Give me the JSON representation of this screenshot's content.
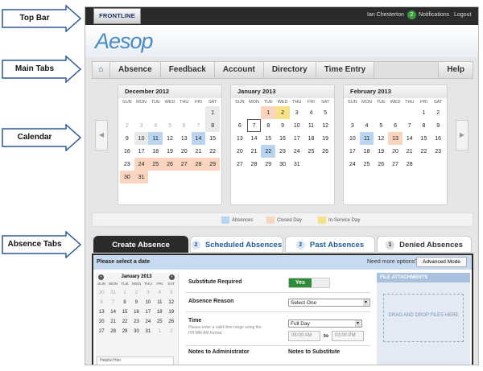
{
  "annotations": {
    "top_bar": "Top Bar",
    "main_tabs": "Main Tabs",
    "calendar": "Calendar",
    "absence_tabs": "Absence Tabs"
  },
  "topbar": {
    "logo": "FRONTLINE",
    "user": "Ian Chesterton",
    "notifications_count": "2",
    "notifications": "Notifications",
    "logout": "Logout"
  },
  "brand": {
    "name": "Aesop"
  },
  "tabs": {
    "home_icon": "home-icon",
    "absence": "Absence",
    "feedback": "Feedback",
    "account": "Account",
    "directory": "Directory",
    "time_entry": "Time Entry",
    "help": "Help"
  },
  "calendars": [
    {
      "title": "December 2012",
      "dow": [
        "SUN",
        "MON",
        "TUE",
        "WED",
        "THU",
        "FRI",
        "SAT"
      ],
      "weeks": [
        [
          [
            "",
            ""
          ],
          [
            "",
            ""
          ],
          [
            "",
            ""
          ],
          [
            "",
            ""
          ],
          [
            "",
            ""
          ],
          [
            "",
            ""
          ],
          [
            "1",
            "g"
          ]
        ],
        [
          [
            "2",
            "o"
          ],
          [
            "3",
            "o"
          ],
          [
            "4",
            "o"
          ],
          [
            "5",
            "o"
          ],
          [
            "6",
            "o"
          ],
          [
            "7",
            "o"
          ],
          [
            "8",
            "g"
          ]
        ],
        [
          [
            "9",
            ""
          ],
          [
            "10",
            "g"
          ],
          [
            "11",
            "a"
          ],
          [
            "12",
            ""
          ],
          [
            "13",
            ""
          ],
          [
            "14",
            "a"
          ],
          [
            "15",
            ""
          ]
        ],
        [
          [
            "16",
            ""
          ],
          [
            "17",
            ""
          ],
          [
            "18",
            ""
          ],
          [
            "19",
            ""
          ],
          [
            "20",
            ""
          ],
          [
            "21",
            ""
          ],
          [
            "22",
            ""
          ]
        ],
        [
          [
            "23",
            ""
          ],
          [
            "24",
            "c"
          ],
          [
            "25",
            "c"
          ],
          [
            "26",
            "c"
          ],
          [
            "27",
            "c"
          ],
          [
            "28",
            "c"
          ],
          [
            "29",
            "c"
          ]
        ],
        [
          [
            "30",
            "c"
          ],
          [
            "31",
            "c"
          ],
          [
            "",
            ""
          ],
          [
            "",
            ""
          ],
          [
            "",
            ""
          ],
          [
            "",
            ""
          ],
          [
            "",
            ""
          ]
        ]
      ]
    },
    {
      "title": "January 2013",
      "dow": [
        "SUN",
        "MON",
        "TUE",
        "WED",
        "THU",
        "FRI",
        "SAT"
      ],
      "weeks": [
        [
          [
            "",
            ""
          ],
          [
            "",
            ""
          ],
          [
            "1",
            "c"
          ],
          [
            "2",
            "i"
          ],
          [
            "3",
            ""
          ],
          [
            "4",
            ""
          ],
          [
            "5",
            ""
          ]
        ],
        [
          [
            "6",
            ""
          ],
          [
            "7",
            "t"
          ],
          [
            "8",
            ""
          ],
          [
            "9",
            ""
          ],
          [
            "10",
            ""
          ],
          [
            "11",
            ""
          ],
          [
            "12",
            ""
          ]
        ],
        [
          [
            "13",
            ""
          ],
          [
            "14",
            ""
          ],
          [
            "15",
            ""
          ],
          [
            "16",
            ""
          ],
          [
            "17",
            ""
          ],
          [
            "18",
            ""
          ],
          [
            "19",
            ""
          ]
        ],
        [
          [
            "20",
            ""
          ],
          [
            "21",
            ""
          ],
          [
            "22",
            "a"
          ],
          [
            "23",
            ""
          ],
          [
            "24",
            ""
          ],
          [
            "25",
            ""
          ],
          [
            "26",
            ""
          ]
        ],
        [
          [
            "27",
            ""
          ],
          [
            "28",
            ""
          ],
          [
            "29",
            ""
          ],
          [
            "30",
            ""
          ],
          [
            "31",
            ""
          ],
          [
            "",
            ""
          ],
          [
            "",
            ""
          ]
        ]
      ]
    },
    {
      "title": "February 2013",
      "dow": [
        "SUN",
        "MON",
        "TUE",
        "WED",
        "THU",
        "FRI",
        "SAT"
      ],
      "weeks": [
        [
          [
            "",
            ""
          ],
          [
            "",
            ""
          ],
          [
            "",
            ""
          ],
          [
            "",
            ""
          ],
          [
            "",
            ""
          ],
          [
            "1",
            ""
          ],
          [
            "2",
            ""
          ]
        ],
        [
          [
            "3",
            ""
          ],
          [
            "4",
            ""
          ],
          [
            "5",
            ""
          ],
          [
            "6",
            ""
          ],
          [
            "7",
            ""
          ],
          [
            "8",
            ""
          ],
          [
            "9",
            ""
          ]
        ],
        [
          [
            "10",
            ""
          ],
          [
            "11",
            "a"
          ],
          [
            "12",
            ""
          ],
          [
            "13",
            "c"
          ],
          [
            "14",
            ""
          ],
          [
            "15",
            ""
          ],
          [
            "16",
            ""
          ]
        ],
        [
          [
            "17",
            ""
          ],
          [
            "18",
            ""
          ],
          [
            "19",
            ""
          ],
          [
            "20",
            ""
          ],
          [
            "21",
            ""
          ],
          [
            "22",
            ""
          ],
          [
            "23",
            ""
          ]
        ],
        [
          [
            "24",
            ""
          ],
          [
            "25",
            ""
          ],
          [
            "26",
            ""
          ],
          [
            "27",
            ""
          ],
          [
            "28",
            ""
          ],
          [
            "",
            ""
          ],
          [
            "",
            ""
          ]
        ]
      ]
    }
  ],
  "legend": {
    "absences": "Absences",
    "closed": "Closed Day",
    "inservice": "In-Service Day"
  },
  "absence_tabs": {
    "create": "Create Absence",
    "scheduled_count": "2",
    "scheduled": "Scheduled Absences",
    "past_count": "2",
    "past": "Past Absences",
    "denied_count": "1",
    "denied": "Denied Absences"
  },
  "panel": {
    "prompt": "Please select a date",
    "more_options": "Need more options?",
    "advanced": "Advanced Mode"
  },
  "mini_cal": {
    "title": "January 2013",
    "dow": [
      "SUN",
      "MON",
      "TUE",
      "WED",
      "THU",
      "FRI",
      "SAT"
    ],
    "weeks": [
      [
        "30",
        "31",
        "1",
        "2",
        "3",
        "4",
        "5"
      ],
      [
        "6",
        "7",
        "8",
        "9",
        "10",
        "11",
        "12"
      ],
      [
        "13",
        "14",
        "15",
        "16",
        "17",
        "18",
        "19"
      ],
      [
        "20",
        "21",
        "22",
        "23",
        "24",
        "25",
        "26"
      ],
      [
        "27",
        "28",
        "29",
        "30",
        "31",
        "1",
        "2"
      ]
    ],
    "helpful": "Helpful Hint"
  },
  "form": {
    "substitute_required": "Substitute Required",
    "yes": "Yes",
    "absence_reason": "Absence Reason",
    "select_one": "Select One",
    "time": "Time",
    "time_hint": "Please enter a valid time range using the HH:MM AM format.",
    "full_day": "Full Day",
    "start": "08:00 AM",
    "to": "to",
    "end": "03:00 PM",
    "notes_admin": "Notes to Administrator",
    "notes_sub": "Notes to Substitute"
  },
  "attachments": {
    "title": "FILE ATTACHMENTS",
    "drop": "DRAG AND DROP FILES HERE"
  }
}
